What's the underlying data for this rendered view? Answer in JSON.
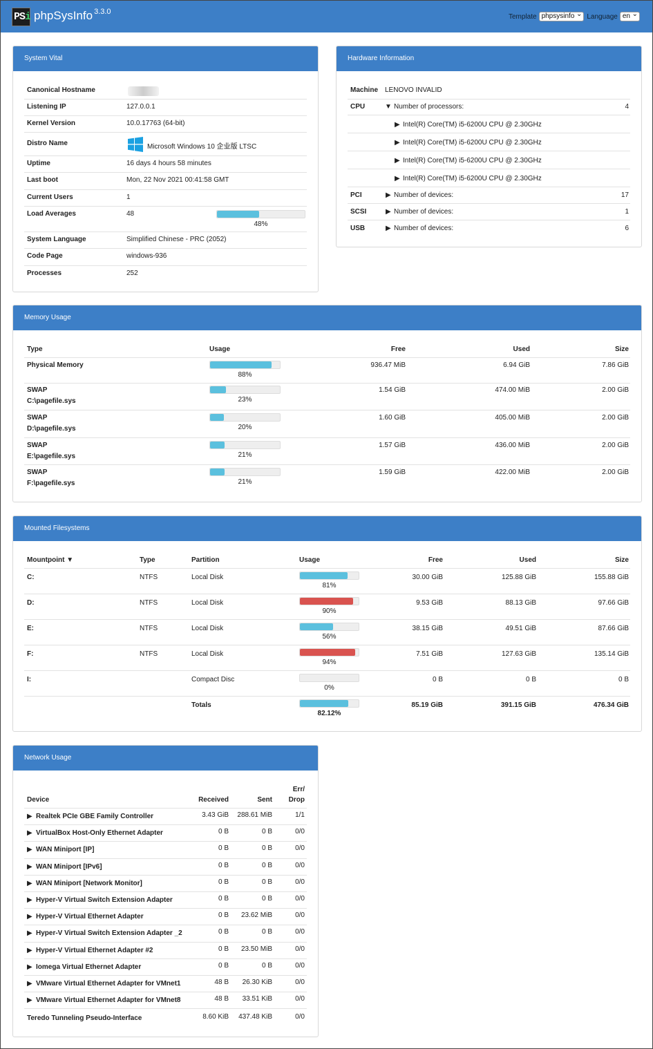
{
  "app": {
    "logo_text": "PS",
    "title": "phpSysInfo",
    "version": "3.3.0"
  },
  "header": {
    "template_label": "Template",
    "template_value": "phpsysinfo",
    "language_label": "Language",
    "language_value": "en"
  },
  "vital": {
    "title": "System Vital",
    "rows": [
      {
        "label": "Canonical Hostname",
        "value": ""
      },
      {
        "label": "Listening IP",
        "value": "127.0.0.1"
      },
      {
        "label": "Kernel Version",
        "value": "10.0.17763 (64-bit)"
      },
      {
        "label": "Distro Name",
        "value": "Microsoft Windows 10 企业版 LTSC"
      },
      {
        "label": "Uptime",
        "value": "16 days 4 hours 58 minutes"
      },
      {
        "label": "Last boot",
        "value": "Mon, 22 Nov 2021 00:41:58 GMT"
      },
      {
        "label": "Current Users",
        "value": "1"
      },
      {
        "label": "Load Averages",
        "value": "48",
        "percent": 48,
        "percent_label": "48%"
      },
      {
        "label": "System Language",
        "value": "Simplified Chinese - PRC (2052)"
      },
      {
        "label": "Code Page",
        "value": "windows-936"
      },
      {
        "label": "Processes",
        "value": "252"
      }
    ]
  },
  "hardware": {
    "title": "Hardware Information",
    "machine_label": "Machine",
    "machine_value": "LENOVO INVALID",
    "cpu_label": "CPU",
    "cpu_summary": "Number of processors:",
    "cpu_count": "4",
    "cpus": [
      "Intel(R) Core(TM) i5-6200U CPU @ 2.30GHz",
      "Intel(R) Core(TM) i5-6200U CPU @ 2.30GHz",
      "Intel(R) Core(TM) i5-6200U CPU @ 2.30GHz",
      "Intel(R) Core(TM) i5-6200U CPU @ 2.30GHz"
    ],
    "buses": [
      {
        "label": "PCI",
        "text": "Number of devices:",
        "count": "17"
      },
      {
        "label": "SCSI",
        "text": "Number of devices:",
        "count": "1"
      },
      {
        "label": "USB",
        "text": "Number of devices:",
        "count": "6"
      }
    ]
  },
  "memory": {
    "title": "Memory Usage",
    "headers": {
      "type": "Type",
      "usage": "Usage",
      "free": "Free",
      "used": "Used",
      "size": "Size"
    },
    "rows": [
      {
        "type": "Physical Memory",
        "sub": "",
        "percent": 88,
        "pct_label": "88%",
        "free": "936.47 MiB",
        "used": "6.94 GiB",
        "size": "7.86 GiB"
      },
      {
        "type": "SWAP",
        "sub": "C:\\pagefile.sys",
        "percent": 23,
        "pct_label": "23%",
        "free": "1.54 GiB",
        "used": "474.00 MiB",
        "size": "2.00 GiB"
      },
      {
        "type": "SWAP",
        "sub": "D:\\pagefile.sys",
        "percent": 20,
        "pct_label": "20%",
        "free": "1.60 GiB",
        "used": "405.00 MiB",
        "size": "2.00 GiB"
      },
      {
        "type": "SWAP",
        "sub": "E:\\pagefile.sys",
        "percent": 21,
        "pct_label": "21%",
        "free": "1.57 GiB",
        "used": "436.00 MiB",
        "size": "2.00 GiB"
      },
      {
        "type": "SWAP",
        "sub": "F:\\pagefile.sys",
        "percent": 21,
        "pct_label": "21%",
        "free": "1.59 GiB",
        "used": "422.00 MiB",
        "size": "2.00 GiB"
      }
    ]
  },
  "filesystems": {
    "title": "Mounted Filesystems",
    "headers": {
      "mount": "Mountpoint ▼",
      "type": "Type",
      "partition": "Partition",
      "usage": "Usage",
      "free": "Free",
      "used": "Used",
      "size": "Size"
    },
    "rows": [
      {
        "mount": "C:",
        "type": "NTFS",
        "partition": "Local Disk",
        "percent": 81,
        "pct_label": "81%",
        "free": "30.00 GiB",
        "used": "125.88 GiB",
        "size": "155.88 GiB",
        "color": "#5bc0de"
      },
      {
        "mount": "D:",
        "type": "NTFS",
        "partition": "Local Disk",
        "percent": 90,
        "pct_label": "90%",
        "free": "9.53 GiB",
        "used": "88.13 GiB",
        "size": "97.66 GiB",
        "color": "#d9534f"
      },
      {
        "mount": "E:",
        "type": "NTFS",
        "partition": "Local Disk",
        "percent": 56,
        "pct_label": "56%",
        "free": "38.15 GiB",
        "used": "49.51 GiB",
        "size": "87.66 GiB",
        "color": "#5bc0de"
      },
      {
        "mount": "F:",
        "type": "NTFS",
        "partition": "Local Disk",
        "percent": 94,
        "pct_label": "94%",
        "free": "7.51 GiB",
        "used": "127.63 GiB",
        "size": "135.14 GiB",
        "color": "#d9534f"
      },
      {
        "mount": "I:",
        "type": "",
        "partition": "Compact Disc",
        "percent": 0,
        "pct_label": "0%",
        "free": "0 B",
        "used": "0 B",
        "size": "0 B",
        "color": "#5bc0de"
      }
    ],
    "totals": {
      "label": "Totals",
      "percent": 82.12,
      "pct_label": "82.12%",
      "free": "85.19 GiB",
      "used": "391.15 GiB",
      "size": "476.34 GiB"
    }
  },
  "network": {
    "title": "Network Usage",
    "headers": {
      "device": "Device",
      "received": "Received",
      "sent": "Sent",
      "err1": "Err/",
      "err2": "Drop"
    },
    "rows": [
      {
        "device": "Realtek PCIe GBE Family Controller",
        "expand": true,
        "received": "3.43 GiB",
        "sent": "288.61 MiB",
        "err": "1/1"
      },
      {
        "device": "VirtualBox Host-Only Ethernet Adapter",
        "expand": true,
        "received": "0 B",
        "sent": "0 B",
        "err": "0/0"
      },
      {
        "device": "WAN Miniport [IP]",
        "expand": true,
        "received": "0 B",
        "sent": "0 B",
        "err": "0/0"
      },
      {
        "device": "WAN Miniport [IPv6]",
        "expand": true,
        "received": "0 B",
        "sent": "0 B",
        "err": "0/0"
      },
      {
        "device": "WAN Miniport [Network Monitor]",
        "expand": true,
        "received": "0 B",
        "sent": "0 B",
        "err": "0/0"
      },
      {
        "device": "Hyper-V Virtual Switch Extension Adapter",
        "expand": true,
        "received": "0 B",
        "sent": "0 B",
        "err": "0/0"
      },
      {
        "device": "Hyper-V Virtual Ethernet Adapter",
        "expand": true,
        "received": "0 B",
        "sent": "23.62 MiB",
        "err": "0/0"
      },
      {
        "device": "Hyper-V Virtual Switch Extension Adapter _2",
        "expand": true,
        "received": "0 B",
        "sent": "0 B",
        "err": "0/0"
      },
      {
        "device": "Hyper-V Virtual Ethernet Adapter #2",
        "expand": true,
        "received": "0 B",
        "sent": "23.50 MiB",
        "err": "0/0"
      },
      {
        "device": "Iomega Virtual Ethernet Adapter",
        "expand": true,
        "received": "0 B",
        "sent": "0 B",
        "err": "0/0"
      },
      {
        "device": "VMware Virtual Ethernet Adapter for VMnet1",
        "expand": true,
        "received": "48 B",
        "sent": "26.30 KiB",
        "err": "0/0"
      },
      {
        "device": "VMware Virtual Ethernet Adapter for VMnet8",
        "expand": true,
        "received": "48 B",
        "sent": "33.51 KiB",
        "err": "0/0"
      },
      {
        "device": "Teredo Tunneling Pseudo-Interface",
        "expand": false,
        "received": "8.60 KiB",
        "sent": "437.48 KiB",
        "err": "0/0"
      }
    ]
  }
}
